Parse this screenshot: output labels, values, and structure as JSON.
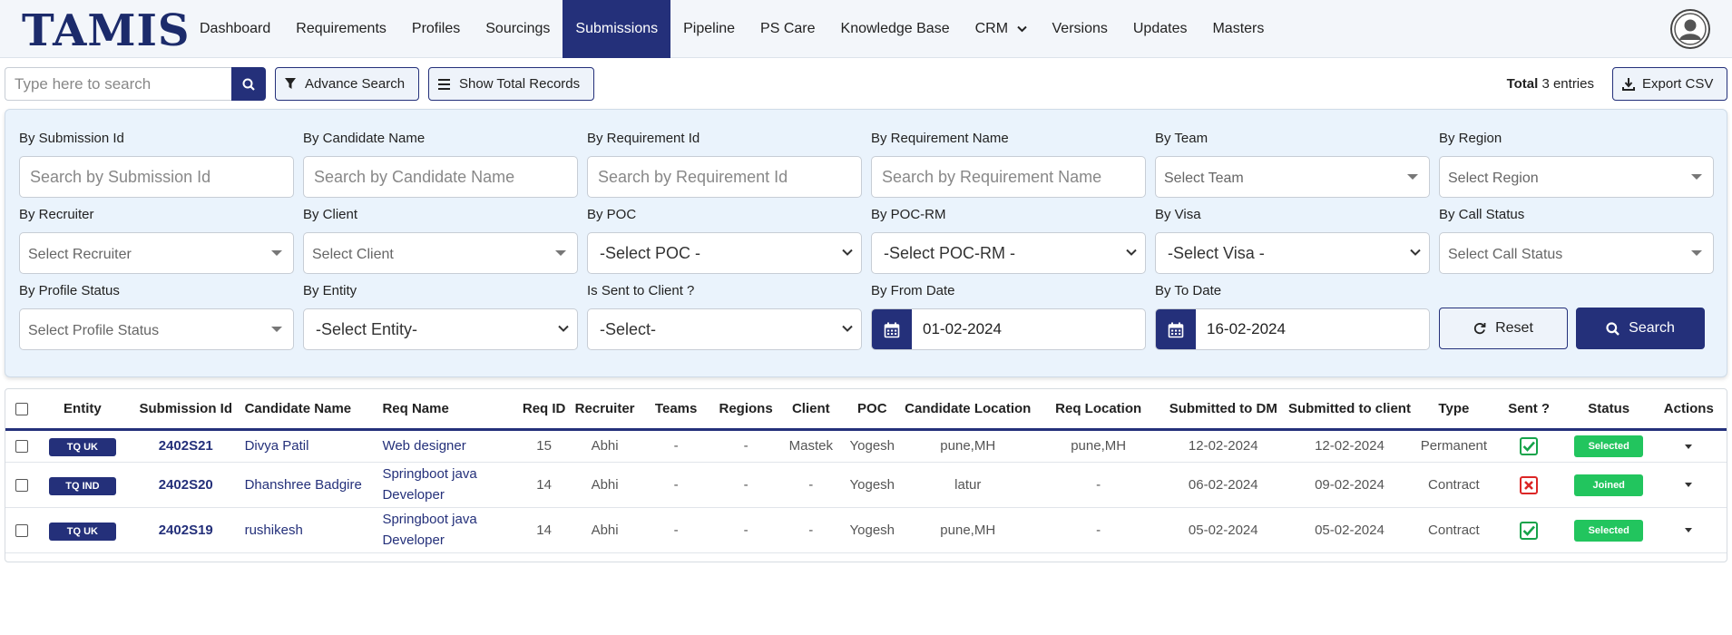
{
  "app": {
    "logo": "TAMIS"
  },
  "nav": {
    "items": [
      {
        "label": "Dashboard"
      },
      {
        "label": "Requirements"
      },
      {
        "label": "Profiles"
      },
      {
        "label": "Sourcings"
      },
      {
        "label": "Submissions",
        "active": true
      },
      {
        "label": "Pipeline"
      },
      {
        "label": "PS Care"
      },
      {
        "label": "Knowledge Base"
      },
      {
        "label": "CRM",
        "dropdown": true
      },
      {
        "label": "Versions"
      },
      {
        "label": "Updates"
      },
      {
        "label": "Masters"
      }
    ]
  },
  "toolbar": {
    "search_placeholder": "Type here to search",
    "advance_search": "Advance Search",
    "show_total": "Show Total Records",
    "total_label": "Total",
    "total_value": "3 entries",
    "export": "Export CSV"
  },
  "filters": {
    "submission_id": {
      "label": "By Submission Id",
      "placeholder": "Search by Submission Id"
    },
    "candidate_name": {
      "label": "By Candidate Name",
      "placeholder": "Search by Candidate Name"
    },
    "requirement_id": {
      "label": "By Requirement Id",
      "placeholder": "Search by Requirement Id"
    },
    "requirement_name": {
      "label": "By Requirement Name",
      "placeholder": "Search by Requirement Name"
    },
    "team": {
      "label": "By Team",
      "value": "Select Team"
    },
    "region": {
      "label": "By Region",
      "value": "Select Region"
    },
    "recruiter": {
      "label": "By Recruiter",
      "value": "Select Recruiter"
    },
    "client": {
      "label": "By Client",
      "value": "Select Client"
    },
    "poc": {
      "label": "By POC",
      "value": "-Select POC -"
    },
    "poc_rm": {
      "label": "By POC-RM",
      "value": "-Select POC-RM -"
    },
    "visa": {
      "label": "By Visa",
      "value": "-Select Visa -"
    },
    "call_status": {
      "label": "By Call Status",
      "value": "Select Call Status"
    },
    "profile_status": {
      "label": "By Profile Status",
      "value": "Select Profile Status"
    },
    "entity": {
      "label": "By Entity",
      "value": "-Select Entity-"
    },
    "sent_to_client": {
      "label": "Is Sent to Client ?",
      "value": "-Select-"
    },
    "from_date": {
      "label": "By From Date",
      "value": "01-02-2024"
    },
    "to_date": {
      "label": "By To Date",
      "value": "16-02-2024"
    },
    "reset": "Reset",
    "search": "Search"
  },
  "table": {
    "headers": [
      "Entity",
      "Submission Id",
      "Candidate Name",
      "Req Name",
      "Req ID",
      "Recruiter",
      "Teams",
      "Regions",
      "Client",
      "POC",
      "Candidate Location",
      "Req Location",
      "Submitted to DM",
      "Submitted to client",
      "Type",
      "Sent ?",
      "Status",
      "Actions"
    ],
    "rows": [
      {
        "entity": "TQ UK",
        "submission_id": "2402S21",
        "candidate": "Divya Patil",
        "req_name": "Web designer",
        "req_id": "15",
        "recruiter": "Abhi",
        "teams": "-",
        "regions": "-",
        "client": "Mastek",
        "poc": "Yogesh",
        "cand_loc": "pune,MH",
        "req_loc": "pune,MH",
        "sub_dm": "12-02-2024",
        "sub_client": "12-02-2024",
        "type": "Permanent",
        "sent": true,
        "status": "Selected"
      },
      {
        "entity": "TQ IND",
        "submission_id": "2402S20",
        "candidate": "Dhanshree Badgire",
        "req_name": "Springboot java Developer",
        "req_id": "14",
        "recruiter": "Abhi",
        "teams": "-",
        "regions": "-",
        "client": "-",
        "poc": "Yogesh",
        "cand_loc": "latur",
        "req_loc": "-",
        "sub_dm": "06-02-2024",
        "sub_client": "09-02-2024",
        "type": "Contract",
        "sent": false,
        "status": "Joined"
      },
      {
        "entity": "TQ UK",
        "submission_id": "2402S19",
        "candidate": "rushikesh",
        "req_name": "Springboot java Developer",
        "req_id": "14",
        "recruiter": "Abhi",
        "teams": "-",
        "regions": "-",
        "client": "-",
        "poc": "Yogesh",
        "cand_loc": "pune,MH",
        "req_loc": "-",
        "sub_dm": "05-02-2024",
        "sub_client": "05-02-2024",
        "type": "Contract",
        "sent": true,
        "status": "Selected"
      }
    ]
  },
  "icons": {
    "search": "search-icon",
    "filter": "filter-icon",
    "list": "list-icon",
    "download": "download-icon",
    "calendar": "calendar-icon",
    "refresh": "refresh-icon",
    "user": "user-circle-icon",
    "check": "check-icon",
    "cross": "cross-icon"
  },
  "colors": {
    "primary": "#24307a",
    "success": "#22c55e",
    "danger": "#dc2626",
    "panel": "#eaf3fc"
  }
}
